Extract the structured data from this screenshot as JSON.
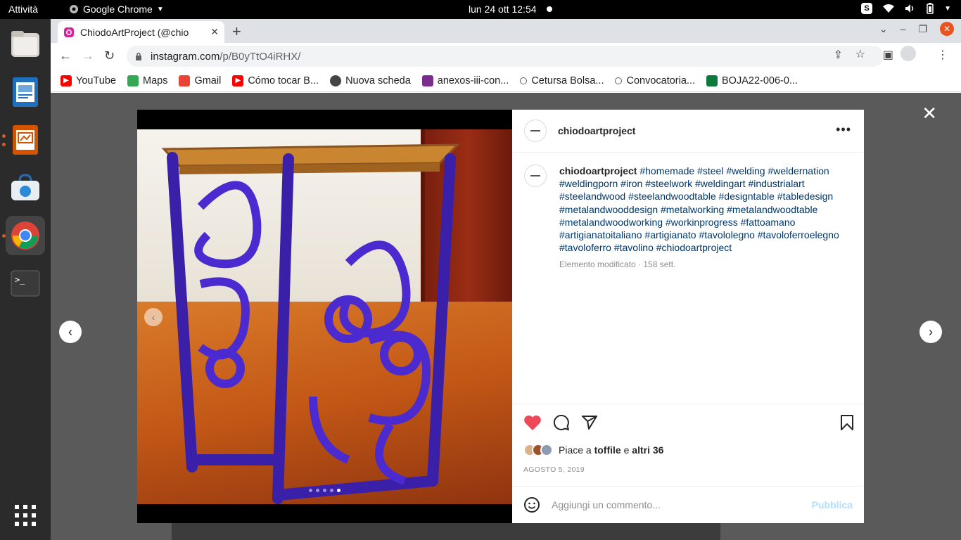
{
  "topbar": {
    "activities": "Attività",
    "app_name": "Google Chrome",
    "datetime": "lun 24 ott  12:54"
  },
  "dock": {
    "items": [
      "files-icon",
      "writer-icon",
      "impress-icon",
      "software-icon",
      "chrome-icon",
      "terminal-icon",
      "apps-grid-icon"
    ]
  },
  "browser": {
    "tab_title": "ChiodoArtProject (@chio",
    "url_domain": "instagram.com",
    "url_path": "/p/B0yTtO4iRHX/",
    "bookmarks": [
      {
        "label": "YouTube",
        "icon": "youtube-icon",
        "color": "#ff0000"
      },
      {
        "label": "Maps",
        "icon": "maps-icon",
        "color": "#34a853"
      },
      {
        "label": "Gmail",
        "icon": "gmail-icon",
        "color": "#ea4335"
      },
      {
        "label": "Cómo tocar B...",
        "icon": "youtube-icon",
        "color": "#ff0000"
      },
      {
        "label": "Nuova scheda",
        "icon": "globe-icon",
        "color": "#444444"
      },
      {
        "label": "anexos-iii-con...",
        "icon": "doc-icon",
        "color": "#7b2c8f"
      },
      {
        "label": "Cetursa Bolsa...",
        "icon": "circle-icon",
        "color": "#5f6368"
      },
      {
        "label": "Convocatoria...",
        "icon": "circle-icon",
        "color": "#5f6368"
      },
      {
        "label": "BOJA22-006-0...",
        "icon": "boja-icon",
        "color": "#0b7a3b"
      }
    ]
  },
  "post": {
    "username": "chiodoartproject",
    "caption_user": "chiodoartproject",
    "caption_tags": "#homemade #steel #welding #weldernation #weldingporn #iron #steelwork #weldingart #industrialart #steelandwood #steelandwoodtable #designtable #tabledesign #metalandwooddesign #metalworking #metalandwoodtable #metalandwoodworking #workinprogress #fattoamano #artigianatoitaliano #artigianato #tavololegno #tavoloferroelegno #tavoloferro #tavolino #chiodoartproject",
    "caption_meta": "Elemento modificato · 158 sett.",
    "likes_prefix": "Piace a",
    "likes_user": "toffile",
    "likes_joiner": "e",
    "likes_others": "altri 36",
    "date": "AGOSTO 5, 2019",
    "comment_placeholder": "Aggiungi un commento...",
    "publish_label": "Pubblica",
    "slide_count": 5,
    "current_slide": 5,
    "liked": true
  }
}
